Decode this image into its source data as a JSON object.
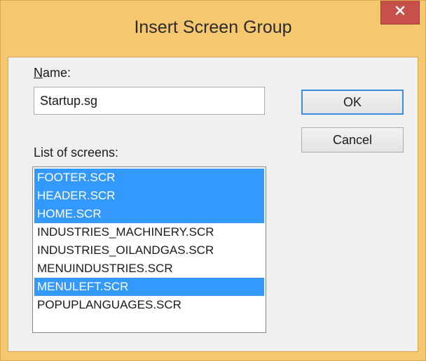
{
  "dialog": {
    "title": "Insert Screen Group",
    "close_label": "✕",
    "name_label_access": "N",
    "name_label_rest": "ame:",
    "name_value": "Startup.sg",
    "ok_label": "OK",
    "cancel_label": "Cancel",
    "list_label": "List of screens:",
    "screens": [
      {
        "label": "FOOTER.SCR",
        "selected": true
      },
      {
        "label": "HEADER.SCR",
        "selected": true
      },
      {
        "label": "HOME.SCR",
        "selected": true
      },
      {
        "label": "INDUSTRIES_MACHINERY.SCR",
        "selected": false
      },
      {
        "label": "INDUSTRIES_OILANDGAS.SCR",
        "selected": false
      },
      {
        "label": "MENUINDUSTRIES.SCR",
        "selected": false
      },
      {
        "label": "MENULEFT.SCR",
        "selected": true
      },
      {
        "label": "POPUPLANGUAGES.SCR",
        "selected": false
      }
    ]
  },
  "colors": {
    "title_bar": "#f5c86f",
    "close_button": "#c7504a",
    "selection": "#3399ff",
    "default_button_border": "#3c8ce0"
  }
}
